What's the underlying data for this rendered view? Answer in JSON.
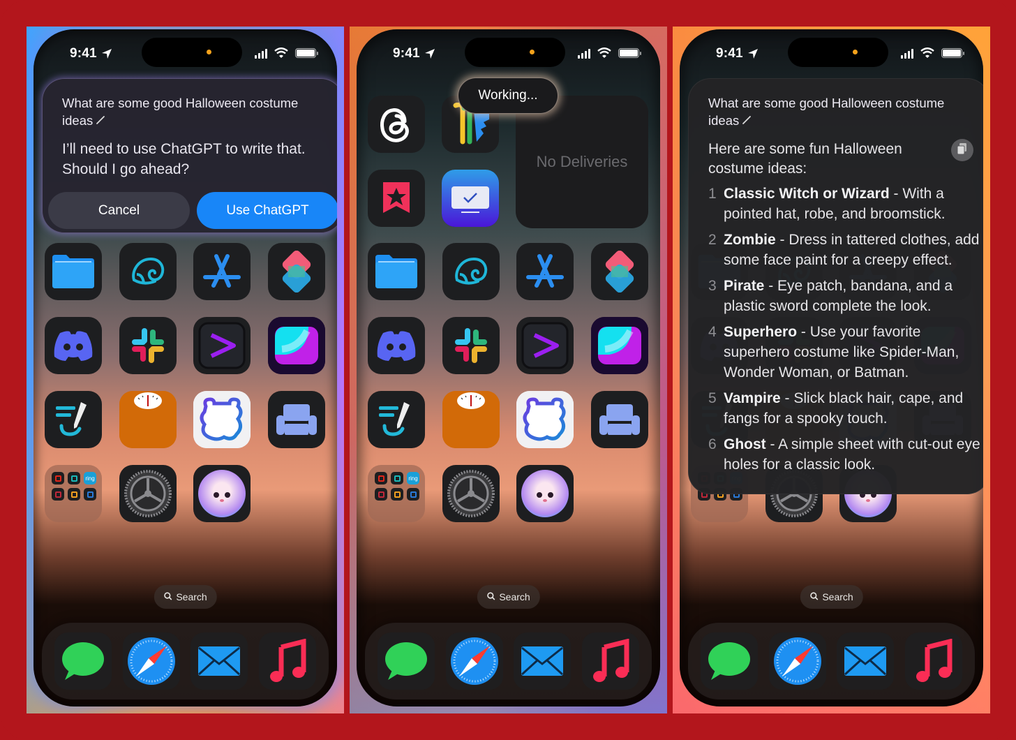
{
  "status": {
    "time": "9:41",
    "location_icon": "location-arrow-icon",
    "signal_icon": "cellular-signal-icon",
    "wifi_icon": "wifi-icon",
    "battery_icon": "battery-icon"
  },
  "colors": {
    "frame": "#b3161c",
    "primary_button": "#1886f8",
    "secondary_button": "#3b3b47",
    "island_dot": "#f7a21b"
  },
  "panel1": {
    "query": "What are some good Halloween costume ideas",
    "prompt": "I’ll need to use ChatGPT to write that. Should I go ahead?",
    "cancel_label": "Cancel",
    "use_label": "Use ChatGPT"
  },
  "panel2": {
    "working_label": "Working...",
    "widget_text": "No Deliveries",
    "top_apps": [
      "Threads",
      "Passwords",
      "GoodLinks",
      "Screen Time"
    ]
  },
  "panel3": {
    "query": "What are some good Halloween costume ideas",
    "intro": "Here are some fun Halloween costume ideas:",
    "copy_icon": "copy-icon",
    "items": [
      {
        "num": "1",
        "title": "Classic Witch or Wizard",
        "desc": " - With a pointed hat, robe, and broomstick."
      },
      {
        "num": "2",
        "title": "Zombie",
        "desc": " - Dress in tattered clothes, add some face paint for a creepy effect."
      },
      {
        "num": "3",
        "title": "Pirate",
        "desc": " - Eye patch, bandana, and a plastic sword complete the look."
      },
      {
        "num": "4",
        "title": "Superhero",
        "desc": " - Use your favorite superhero costume like Spider-Man, Wonder Woman, or Batman."
      },
      {
        "num": "5",
        "title": "Vampire",
        "desc": " - Slick black hair, cape, and fangs for a spooky touch."
      },
      {
        "num": "6",
        "title": "Ghost",
        "desc": " - A simple sheet with cut-out eye holes for a classic look."
      }
    ]
  },
  "home_apps": [
    "Files",
    "Nautilus",
    "App Store",
    "Shortcuts",
    "Discord",
    "Slack",
    "Prompt",
    "Screens",
    "Notes Writer",
    "Scale",
    "Bear",
    "Couch",
    "Home Folder",
    "Settings",
    "Pet App"
  ],
  "folder_apps": [
    "Umbrella",
    "Sync",
    "ring",
    "Home",
    "Google Home",
    "Snowflake"
  ],
  "search_label": "Search",
  "dock_apps": [
    "Messages",
    "Safari",
    "Mail",
    "Music"
  ]
}
